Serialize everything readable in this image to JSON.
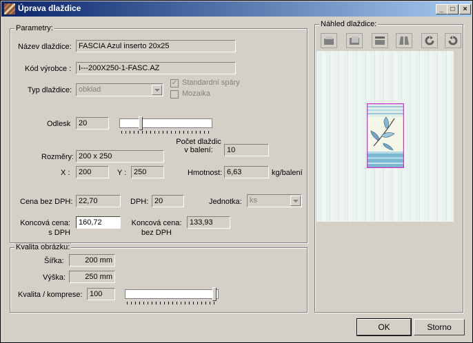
{
  "window": {
    "title": "Úprava dlaždice",
    "controls": {
      "minimize": "_",
      "maximize": "□",
      "close": "×"
    }
  },
  "params": {
    "group_label": "Parametry:",
    "name_label": "Název dlaždice:",
    "name_value": "FASCIA Azul inserto 20x25",
    "code_label": "Kód výrobce :",
    "code_value": "I---200X250-1-FASC.AZ",
    "type_label": "Typ dlaždice:",
    "type_value": "obklad",
    "std_joints_label": "Standardní spáry",
    "std_joints_checked": true,
    "mosaic_label": "Mozaika",
    "mosaic_checked": false,
    "gloss_label": "Odlesk",
    "gloss_value": "20",
    "gloss_level": 0.2,
    "dimensions_label": "Rozměry:",
    "dimensions_value": "200 x 250",
    "x_label": "X :",
    "x_value": "200",
    "y_label": "Y :",
    "y_value": "250",
    "count_label_1": "Počet dlaždic",
    "count_label_2": "v balení:",
    "count_value": "10",
    "weight_label": "Hmotnost:",
    "weight_value": "6,63",
    "weight_unit": "kg/balení",
    "price_no_vat_label": "Cena bez DPH:",
    "price_no_vat_value": "22,70",
    "vat_label": "DPH:",
    "vat_value": "20",
    "unit_label": "Jednotka:",
    "unit_value": "ks",
    "final_price_label_1": "Koncová cena:",
    "final_price_label_2": "s DPH",
    "final_price_value": "160,72",
    "final_price_novat_label_1": "Koncová cena:",
    "final_price_novat_label_2": "bez DPH",
    "final_price_novat_value": "133,93"
  },
  "quality": {
    "group_label": "Kvalita obrázku:",
    "width_label": "Šířka:",
    "width_value": "200 mm",
    "height_label": "Výška:",
    "height_value": "250 mm",
    "compression_label": "Kvalita / komprese:",
    "compression_value": "100",
    "compression_level": 1.0
  },
  "preview": {
    "group_label": "Náhled dlaždice:",
    "tools": [
      "fit-icon",
      "center-icon",
      "top-view-icon",
      "perspective-icon",
      "rotate-right-icon",
      "rotate-left-icon"
    ],
    "accent_color": "#cc33cc"
  },
  "buttons": {
    "ok": "OK",
    "cancel": "Storno"
  }
}
